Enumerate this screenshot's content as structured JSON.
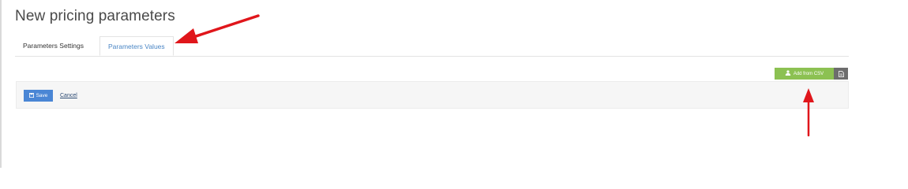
{
  "page": {
    "title": "New pricing parameters"
  },
  "tabs": [
    {
      "label": "Parameters Settings",
      "active": false
    },
    {
      "label": "Parameters Values",
      "active": true
    }
  ],
  "toolbar": {
    "add_csv_label": "Add from CSV",
    "add_csv_icon": "upload-user-icon",
    "doc_icon": "document-icon"
  },
  "actions": {
    "save_label": "Save",
    "save_icon": "floppy-disk-icon",
    "cancel_label": "Cancel"
  },
  "colors": {
    "accent_blue": "#4a86d5",
    "csv_green": "#8cc152",
    "annotation_red": "#e0161b"
  }
}
